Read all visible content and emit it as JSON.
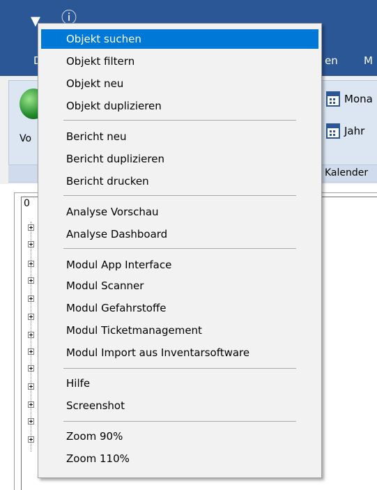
{
  "titlebar": {
    "tab_partial_1": "D",
    "tab_partial_2": "en",
    "tab_partial_3": "M"
  },
  "ribbon": {
    "big_button_label_partial": "Vo",
    "calendar_month_partial": "Mona",
    "calendar_year_partial": "Jahr",
    "group_calendar_partial": "Kalender"
  },
  "tree": {
    "header_partial": "0"
  },
  "menu": {
    "items": [
      {
        "label": "Objekt suchen"
      },
      {
        "label": "Objekt filtern"
      },
      {
        "label": "Objekt neu"
      },
      {
        "label": "Objekt duplizieren"
      },
      {
        "label": "Bericht neu"
      },
      {
        "label": "Bericht duplizieren"
      },
      {
        "label": "Bericht drucken"
      },
      {
        "label": "Analyse Vorschau"
      },
      {
        "label": "Analyse Dashboard"
      },
      {
        "label": "Modul App Interface"
      },
      {
        "label": "Modul Scanner"
      },
      {
        "label": "Modul Gefahrstoffe"
      },
      {
        "label": "Modul Ticketmanagement"
      },
      {
        "label": "Modul Import aus Inventarsoftware"
      },
      {
        "label": "Hilfe"
      },
      {
        "label": "Screenshot"
      },
      {
        "label": "Zoom 90%"
      },
      {
        "label": "Zoom 110%"
      }
    ]
  },
  "colors": {
    "titlebar": "#2b5797",
    "menu_highlight": "#0078d7",
    "menu_background": "#f2f2f2"
  }
}
